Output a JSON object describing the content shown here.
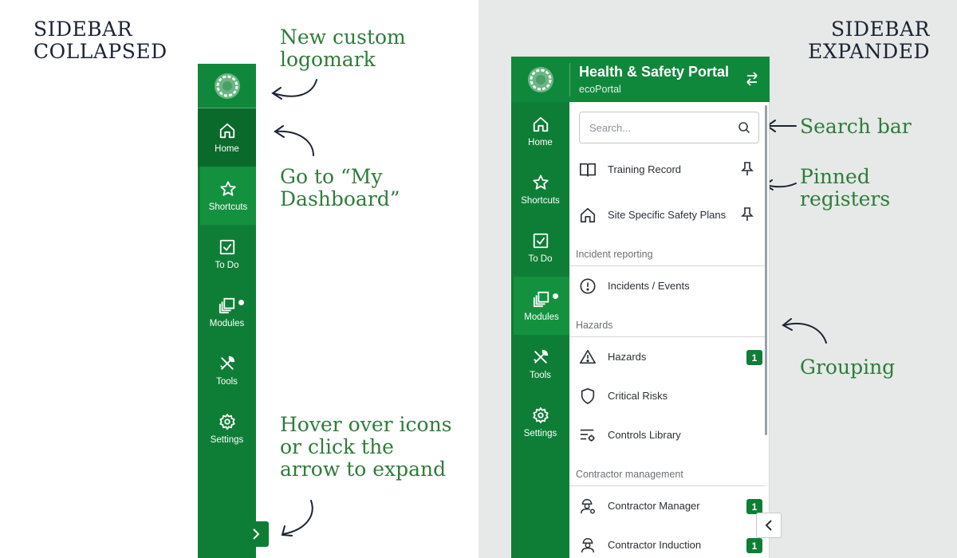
{
  "annotations": {
    "collapsed_heading_line1": "SIDEBAR",
    "collapsed_heading_line2": "COLLAPSED",
    "expanded_heading_line1": "SIDEBAR",
    "expanded_heading_line2": "EXPANDED",
    "logomark_line1": "New custom",
    "logomark_line2": "logomark",
    "dashboard_line1": "Go to “My",
    "dashboard_line2": "Dashboard”",
    "hover_line1": "Hover over icons",
    "hover_line2": "or click the",
    "hover_line3": "arrow to expand",
    "search_bar": "Search bar",
    "pinned_line1": "Pinned",
    "pinned_line2": "registers",
    "grouping": "Grouping"
  },
  "nav": {
    "home": "Home",
    "shortcuts": "Shortcuts",
    "todo": "To Do",
    "modules": "Modules",
    "tools": "Tools",
    "settings": "Settings"
  },
  "header": {
    "title": "Health & Safety Portal",
    "subtitle": "ecoPortal"
  },
  "search": {
    "placeholder": "Search..."
  },
  "pinned": [
    {
      "label": "Training Record",
      "icon": "book-icon"
    },
    {
      "label": "Site Specific Safety Plans",
      "icon": "house-icon"
    }
  ],
  "groups": {
    "incident": "Incident reporting",
    "hazards": "Hazards",
    "contractor": "Contractor management"
  },
  "items": {
    "incidents": "Incidents / Events",
    "hazards": "Hazards",
    "hazards_badge": "1",
    "critical_risks": "Critical Risks",
    "controls_library": "Controls Library",
    "contractor_manager": "Contractor Manager",
    "contractor_manager_badge": "1",
    "contractor_induction": "Contractor Induction",
    "contractor_induction_badge": "1"
  },
  "colors": {
    "brand_green": "#0e7e36",
    "annotation_green": "#2e7d3a",
    "heading_navy": "#1b2433"
  }
}
